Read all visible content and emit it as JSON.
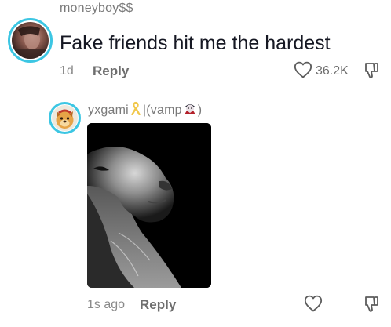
{
  "comment": {
    "username": "moneyboy$$",
    "text": "Fake friends hit me the hardest",
    "age": "1d",
    "reply_label": "Reply",
    "like_count": "36.2K",
    "like_icon": "heart-outline-icon",
    "dislike_icon": "thumbs-down-icon"
  },
  "reply": {
    "username_prefix": "yxgami",
    "username_middle": "|(vamp",
    "username_suffix": ")",
    "username_emojis": [
      "yellow-ribbon-icon",
      "vampire-icon"
    ],
    "age": "1s ago",
    "reply_label": "Reply",
    "like_icon": "heart-outline-icon",
    "dislike_icon": "thumbs-down-icon"
  },
  "colors": {
    "ring": "#3cc6e3",
    "username": "#7a7a7a",
    "text": "#161823",
    "meta": "#8a8a8a"
  }
}
